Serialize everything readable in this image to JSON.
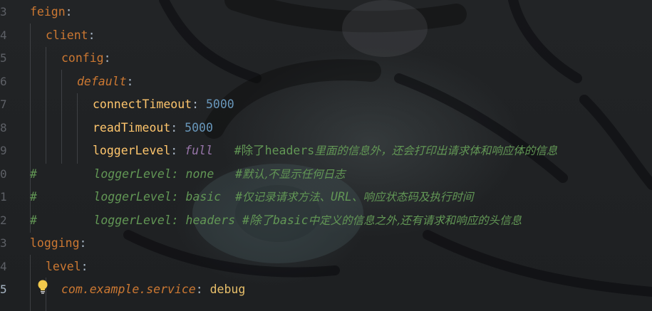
{
  "gutter": {
    "line_numbers": [
      "3",
      "4",
      "5",
      "6",
      "7",
      "8",
      "9",
      "0",
      "1",
      "2",
      "3",
      "4",
      "5"
    ],
    "current_line": "5"
  },
  "code": {
    "l3": {
      "key": "feign",
      "colon": ":"
    },
    "l4": {
      "key": "client",
      "colon": ":"
    },
    "l5": {
      "key": "config",
      "colon": ":"
    },
    "l6": {
      "key": "default",
      "colon": ":"
    },
    "l7": {
      "key": "connectTimeout",
      "colon": ": ",
      "value": "5000"
    },
    "l8": {
      "key": "readTimeout",
      "colon": ": ",
      "value": "5000"
    },
    "l9": {
      "key": "loggerLevel",
      "colon": ": ",
      "value": "full",
      "comment_hash": "#除了",
      "comment_code": "headers",
      "comment_cjk": "里面的信息外，还会打印出请求体和响应体的信息"
    },
    "l10": {
      "hash": "#",
      "code": "        loggerLevel: none   ",
      "comment_hash": "#",
      "comment_cjk": "默认,不显示任何日志"
    },
    "l11": {
      "hash": "#",
      "code": "        loggerLevel: basic  ",
      "comment_hash": "#",
      "comment_cjk1": "仅记录请求方法、",
      "comment_code": "URL",
      "comment_cjk2": "、响应状态码及执行时间"
    },
    "l12": {
      "hash": "#",
      "code": "        loggerLevel: headers ",
      "comment_hash": "#除了",
      "comment_code": "basic",
      "comment_cjk": "中定义的信息之外,还有请求和响应的头信息"
    },
    "l13": {
      "key": "logging",
      "colon": ":"
    },
    "l14": {
      "key": "level",
      "colon": ":"
    },
    "l15": {
      "key": "com.example.service",
      "colon": ": ",
      "value": "debug"
    }
  },
  "icons": {
    "intention": "lightbulb-icon"
  },
  "colors": {
    "background": "#1f2123",
    "key": "#cc7832",
    "sub_key": "#ffc66d",
    "number": "#6897bb",
    "enum_value": "#9876aa",
    "string_value": "#e8bf6a",
    "comment": "#629755",
    "line_number": "#5d6066",
    "bulb": "#f2c94c"
  }
}
